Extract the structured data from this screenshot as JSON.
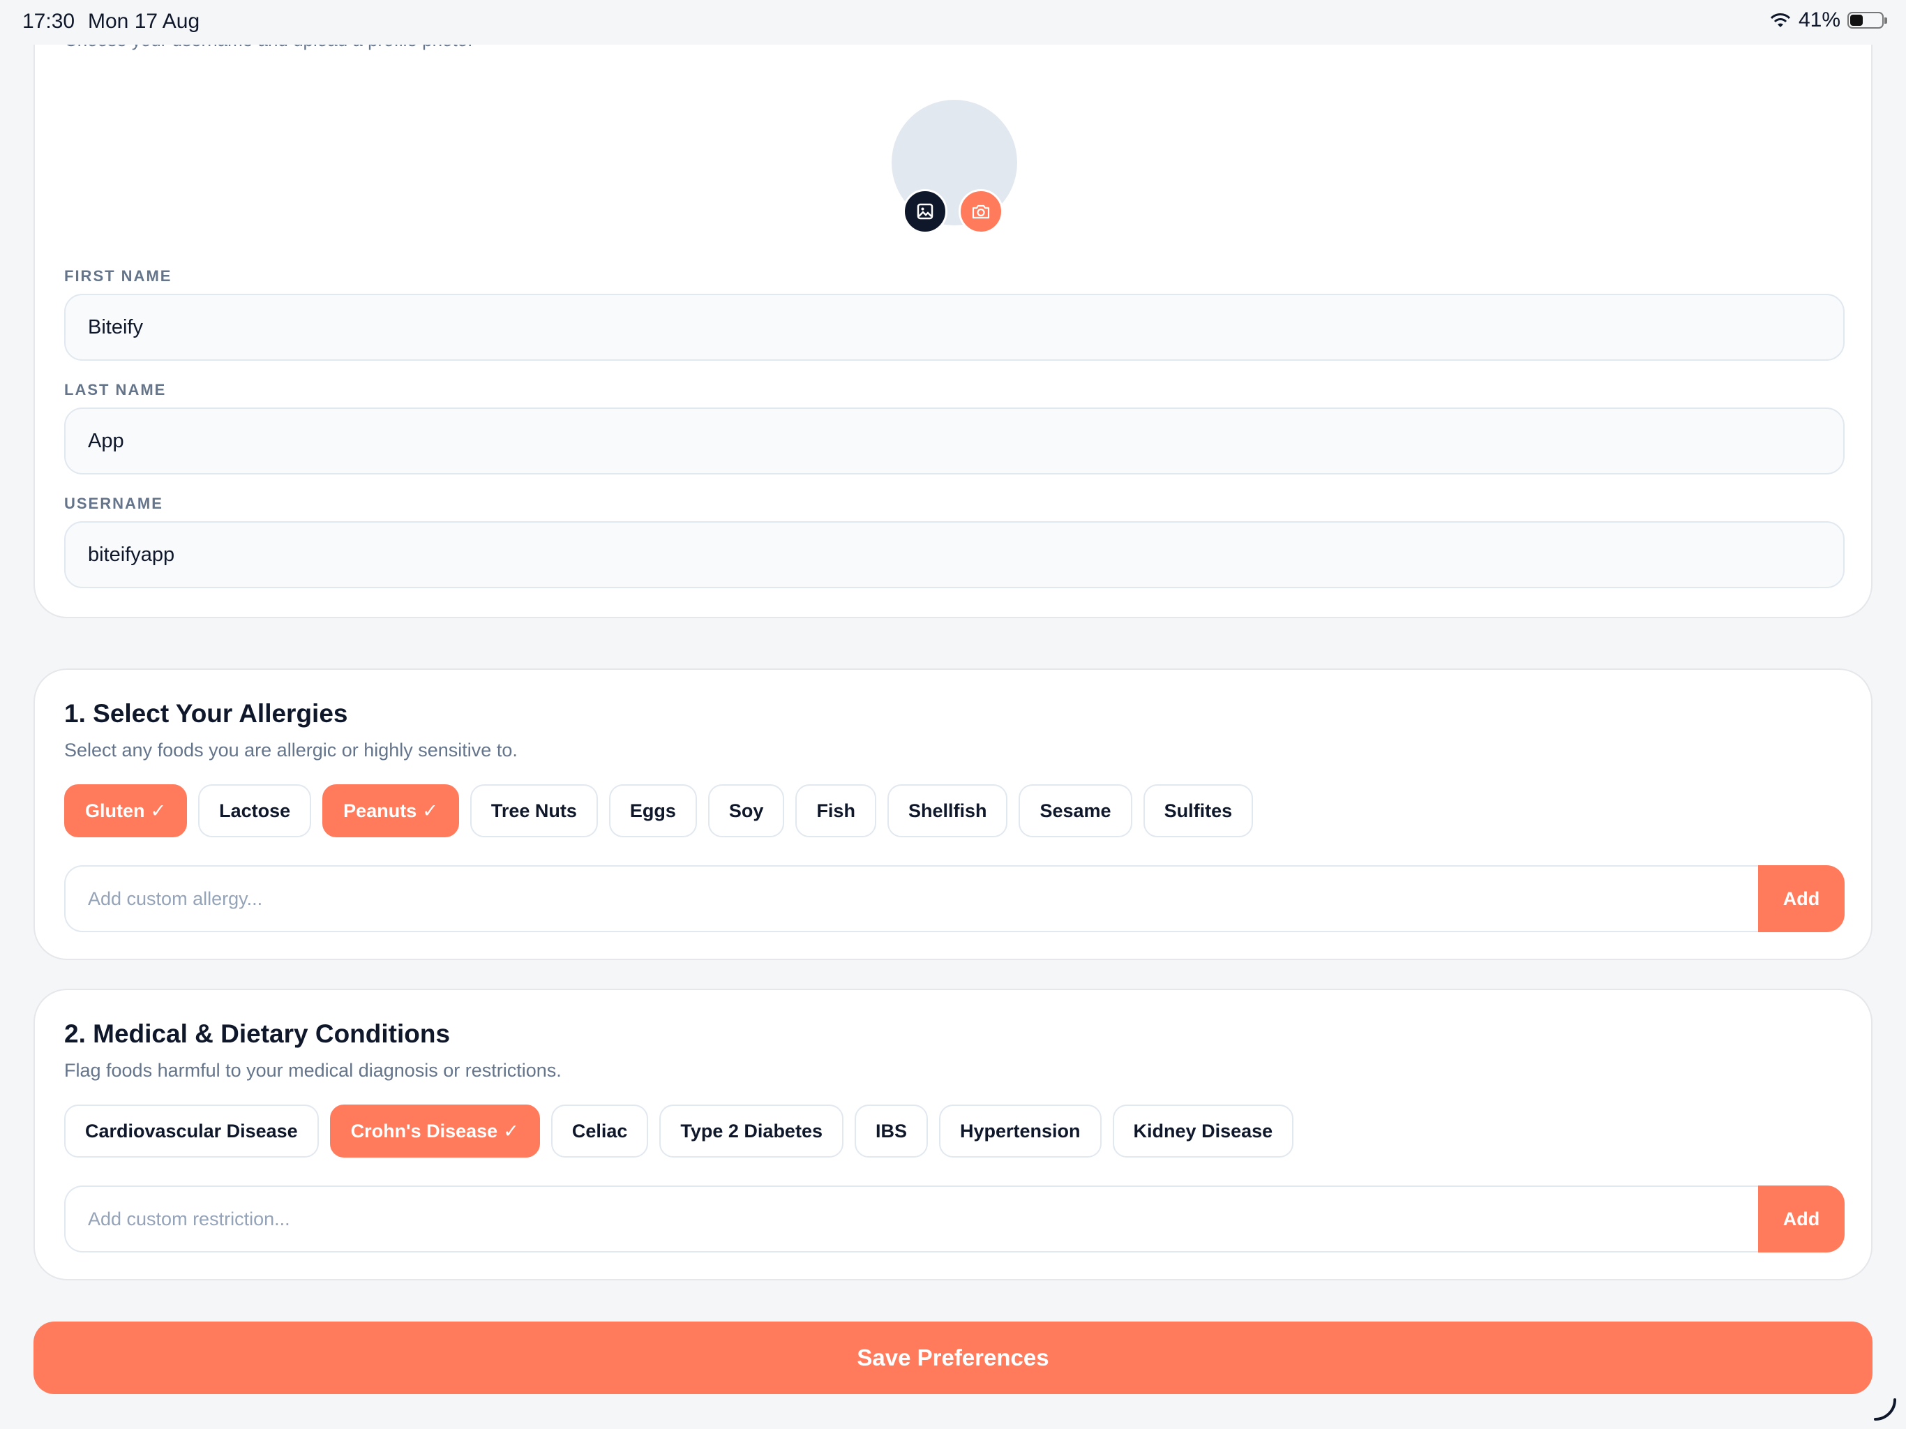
{
  "status_bar": {
    "time": "17:30",
    "date": "Mon 17 Aug",
    "battery": "41%"
  },
  "profile": {
    "subtitle": "Choose your username and upload a profile photo.",
    "first_name_label": "FIRST NAME",
    "first_name_value": "Biteify",
    "last_name_label": "LAST NAME",
    "last_name_value": "App",
    "username_label": "USERNAME",
    "username_value": "biteifyapp"
  },
  "allergies": {
    "title": "1. Select Your Allergies",
    "description": "Select any foods you are allergic or highly sensitive to.",
    "chips": [
      {
        "label": "Gluten",
        "selected": true
      },
      {
        "label": "Lactose",
        "selected": false
      },
      {
        "label": "Peanuts",
        "selected": true
      },
      {
        "label": "Tree Nuts",
        "selected": false
      },
      {
        "label": "Eggs",
        "selected": false
      },
      {
        "label": "Soy",
        "selected": false
      },
      {
        "label": "Fish",
        "selected": false
      },
      {
        "label": "Shellfish",
        "selected": false
      },
      {
        "label": "Sesame",
        "selected": false
      },
      {
        "label": "Sulfites",
        "selected": false
      }
    ],
    "custom_placeholder": "Add custom allergy...",
    "add_label": "Add"
  },
  "conditions": {
    "title": "2. Medical & Dietary Conditions",
    "description": "Flag foods harmful to your medical diagnosis or restrictions.",
    "chips": [
      {
        "label": "Cardiovascular Disease",
        "selected": false
      },
      {
        "label": "Crohn's Disease",
        "selected": true
      },
      {
        "label": "Celiac",
        "selected": false
      },
      {
        "label": "Type 2 Diabetes",
        "selected": false
      },
      {
        "label": "IBS",
        "selected": false
      },
      {
        "label": "Hypertension",
        "selected": false
      },
      {
        "label": "Kidney Disease",
        "selected": false
      }
    ],
    "custom_placeholder": "Add custom restriction...",
    "add_label": "Add"
  },
  "save_label": "Save Preferences",
  "colors": {
    "accent": "#ff7b5c",
    "dark": "#0f172a",
    "muted": "#64748b",
    "background": "#f5f6f8"
  },
  "icons": {
    "gallery": "image-icon",
    "camera": "camera-icon",
    "check": "checkmark-icon",
    "wifi": "wifi-icon",
    "battery": "battery-icon"
  },
  "battery_level": 0.41
}
